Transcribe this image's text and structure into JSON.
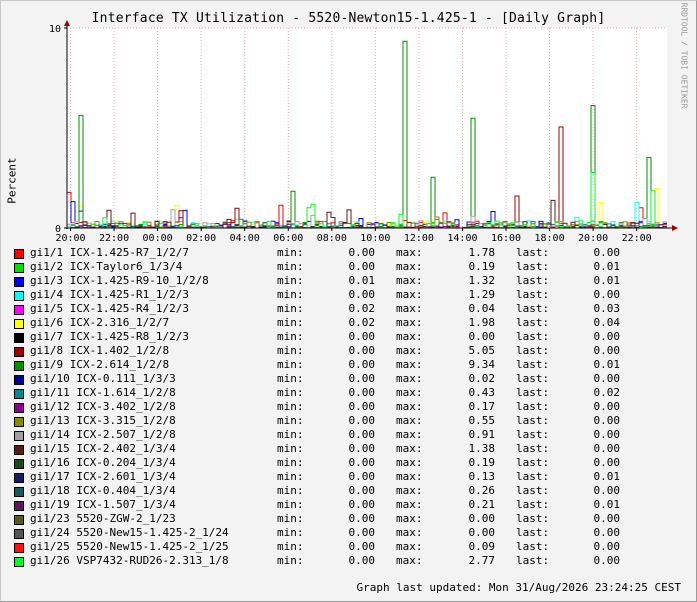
{
  "chart_data": {
    "type": "line",
    "title": "Interface TX Utilization - 5520-Newton15-1.425-1 - [Daily Graph]",
    "ylabel": "Percent",
    "watermark": "RRDTOOL / TOBI OETIKER",
    "ylim": [
      0,
      10
    ],
    "y_ticks": [
      "0",
      "10"
    ],
    "x_ticks": [
      "20:00",
      "22:00",
      "00:00",
      "02:00",
      "04:00",
      "06:00",
      "08:00",
      "10:00",
      "12:00",
      "14:00",
      "16:00",
      "18:00",
      "20:00",
      "22:00"
    ],
    "grid": true,
    "legend_position": "bottom",
    "footer": "Graph last updated: Mon 31/Aug/2026 23:24:25 CEST",
    "series": [
      {
        "name": "gi1/1 ICX-1.425-R7_1/2/7",
        "color": "#ff0000",
        "min": "0.00",
        "max": "1.78",
        "last": "0.00"
      },
      {
        "name": "gi1/2 ICX-Taylor6_1/3/4",
        "color": "#00e000",
        "min": "0.00",
        "max": "0.19",
        "last": "0.01"
      },
      {
        "name": "gi1/3 ICX-1.425-R9-10_1/2/8",
        "color": "#0000ff",
        "min": "0.01",
        "max": "1.32",
        "last": "0.01"
      },
      {
        "name": "gi1/4 ICX-1.425-R1_1/2/3",
        "color": "#00ffff",
        "min": "0.00",
        "max": "1.29",
        "last": "0.00"
      },
      {
        "name": "gi1/5 ICX-1.425-R4_1/2/3",
        "color": "#ff00ff",
        "min": "0.02",
        "max": "0.04",
        "last": "0.03"
      },
      {
        "name": "gi1/6 ICX-2.316_1/2/7",
        "color": "#ffff00",
        "min": "0.02",
        "max": "1.98",
        "last": "0.04"
      },
      {
        "name": "gi1/7 ICX-1.425-R8_1/2/3",
        "color": "#000000",
        "min": "0.00",
        "max": "0.00",
        "last": "0.00"
      },
      {
        "name": "gi1/8 ICX-1.402_1/2/8",
        "color": "#a00000",
        "min": "0.00",
        "max": "5.05",
        "last": "0.00"
      },
      {
        "name": "gi1/9 ICX-2.614_1/2/8",
        "color": "#009000",
        "min": "0.00",
        "max": "9.34",
        "last": "0.01"
      },
      {
        "name": "gi1/10 ICX-0.111_1/3/3",
        "color": "#00008b",
        "min": "0.00",
        "max": "0.02",
        "last": "0.00"
      },
      {
        "name": "gi1/11 ICX-1.614_1/2/8",
        "color": "#008b8b",
        "min": "0.00",
        "max": "0.43",
        "last": "0.02"
      },
      {
        "name": "gi1/12 ICX-3.402_1/2/8",
        "color": "#8b008b",
        "min": "0.00",
        "max": "0.17",
        "last": "0.00"
      },
      {
        "name": "gi1/13 ICX-3.315_1/2/8",
        "color": "#8b8b00",
        "min": "0.00",
        "max": "0.55",
        "last": "0.00"
      },
      {
        "name": "gi1/14 ICX-2.507_1/2/8",
        "color": "#a0a0a0",
        "min": "0.00",
        "max": "0.91",
        "last": "0.00"
      },
      {
        "name": "gi1/15 ICX-2.402_1/3/4",
        "color": "#5a1a1a",
        "min": "0.00",
        "max": "1.38",
        "last": "0.00"
      },
      {
        "name": "gi1/16 ICX-0.204_1/3/4",
        "color": "#1a4a1a",
        "min": "0.00",
        "max": "0.19",
        "last": "0.00"
      },
      {
        "name": "gi1/17 ICX-2.601_1/3/4",
        "color": "#1a1a5a",
        "min": "0.00",
        "max": "0.13",
        "last": "0.01"
      },
      {
        "name": "gi1/18 ICX-0.404_1/3/4",
        "color": "#1a5a5a",
        "min": "0.00",
        "max": "0.26",
        "last": "0.00"
      },
      {
        "name": "gi1/19 ICX-1.507_1/3/4",
        "color": "#5a1a5a",
        "min": "0.00",
        "max": "0.21",
        "last": "0.01"
      },
      {
        "name": "gi1/23 5520-ZGW-2_1/23",
        "color": "#5a5a1a",
        "min": "0.00",
        "max": "0.00",
        "last": "0.00"
      },
      {
        "name": "gi1/24 5520-New15-1.425-2_1/24",
        "color": "#555555",
        "min": "0.00",
        "max": "0.00",
        "last": "0.00"
      },
      {
        "name": "gi1/25 5520-New15-1.425-2_1/25",
        "color": "#ff1010",
        "min": "0.00",
        "max": "0.09",
        "last": "0.00"
      },
      {
        "name": "gi1/26 VSP7432-RUD26-2.313_1/8",
        "color": "#00ff20",
        "min": "0.00",
        "max": "2.77",
        "last": "0.00"
      }
    ],
    "labels": {
      "min": "min:",
      "max": "max:",
      "last": "last:"
    }
  }
}
